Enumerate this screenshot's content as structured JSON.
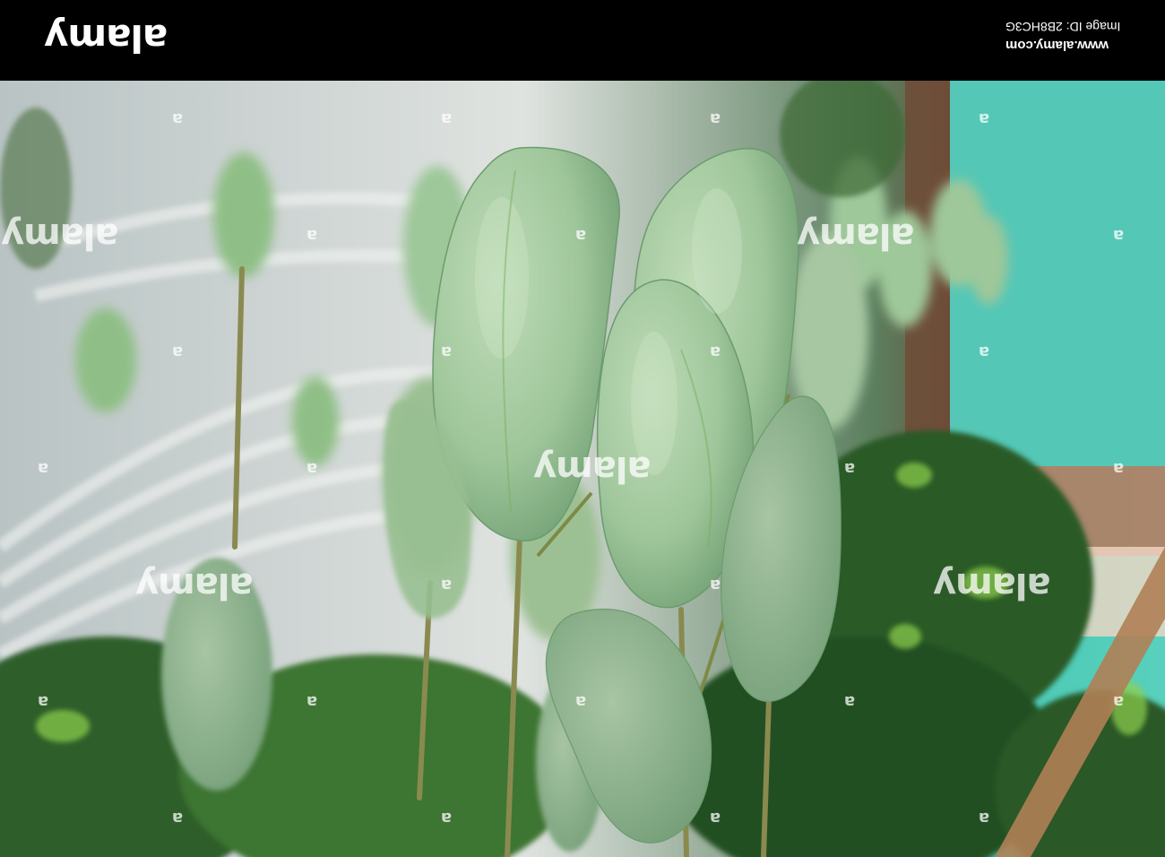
{
  "header": {
    "brand": "alamy",
    "site": "www.alamy.com",
    "image_id_text": "Image ID: 2B8HC3G"
  },
  "photo": {
    "subject": "green mangoes hanging on tree branches",
    "colors": {
      "mango": "#a9c9a1",
      "mango_shade": "#7fae82",
      "leaf": "#2f5e2a",
      "teal_wall": "#55c9b8",
      "roof": "#c9d1d3"
    }
  },
  "watermark": {
    "small_glyph": "a",
    "big_word": "alamy"
  }
}
